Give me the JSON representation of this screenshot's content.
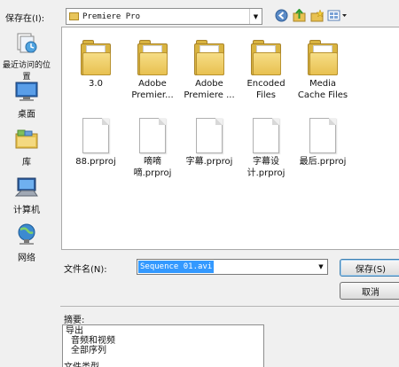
{
  "dialog": {
    "save_in_label": "保存在(I):",
    "location": "Premiere Pro"
  },
  "places": [
    {
      "label": "最近访问的位置",
      "icon": "recent-places-icon"
    },
    {
      "label": "桌面",
      "icon": "desktop-icon"
    },
    {
      "label": "库",
      "icon": "libraries-icon"
    },
    {
      "label": "计算机",
      "icon": "computer-icon"
    },
    {
      "label": "网络",
      "icon": "network-icon"
    }
  ],
  "files": [
    {
      "name": "3.0",
      "kind": "folder"
    },
    {
      "name": "Adobe Premier...",
      "kind": "folder"
    },
    {
      "name": "Adobe Premiere ...",
      "kind": "folder"
    },
    {
      "name": "Encoded Files",
      "kind": "folder"
    },
    {
      "name": "Media Cache Files",
      "kind": "folder"
    },
    {
      "name": "88.prproj",
      "kind": "document"
    },
    {
      "name": "嘀嘀嘀.prproj",
      "kind": "document"
    },
    {
      "name": "字幕.prproj",
      "kind": "document"
    },
    {
      "name": "字幕设计.prproj",
      "kind": "document"
    },
    {
      "name": "最后.prproj",
      "kind": "document"
    }
  ],
  "filename": {
    "label": "文件名(N):",
    "value": "Sequence 01.avi"
  },
  "buttons": {
    "save": "保存(S)",
    "cancel": "取消"
  },
  "summary": {
    "label": "摘要:",
    "lines": [
      "导出",
      "音频和视频",
      "全部序列"
    ]
  },
  "file_type_label": "文件类型"
}
